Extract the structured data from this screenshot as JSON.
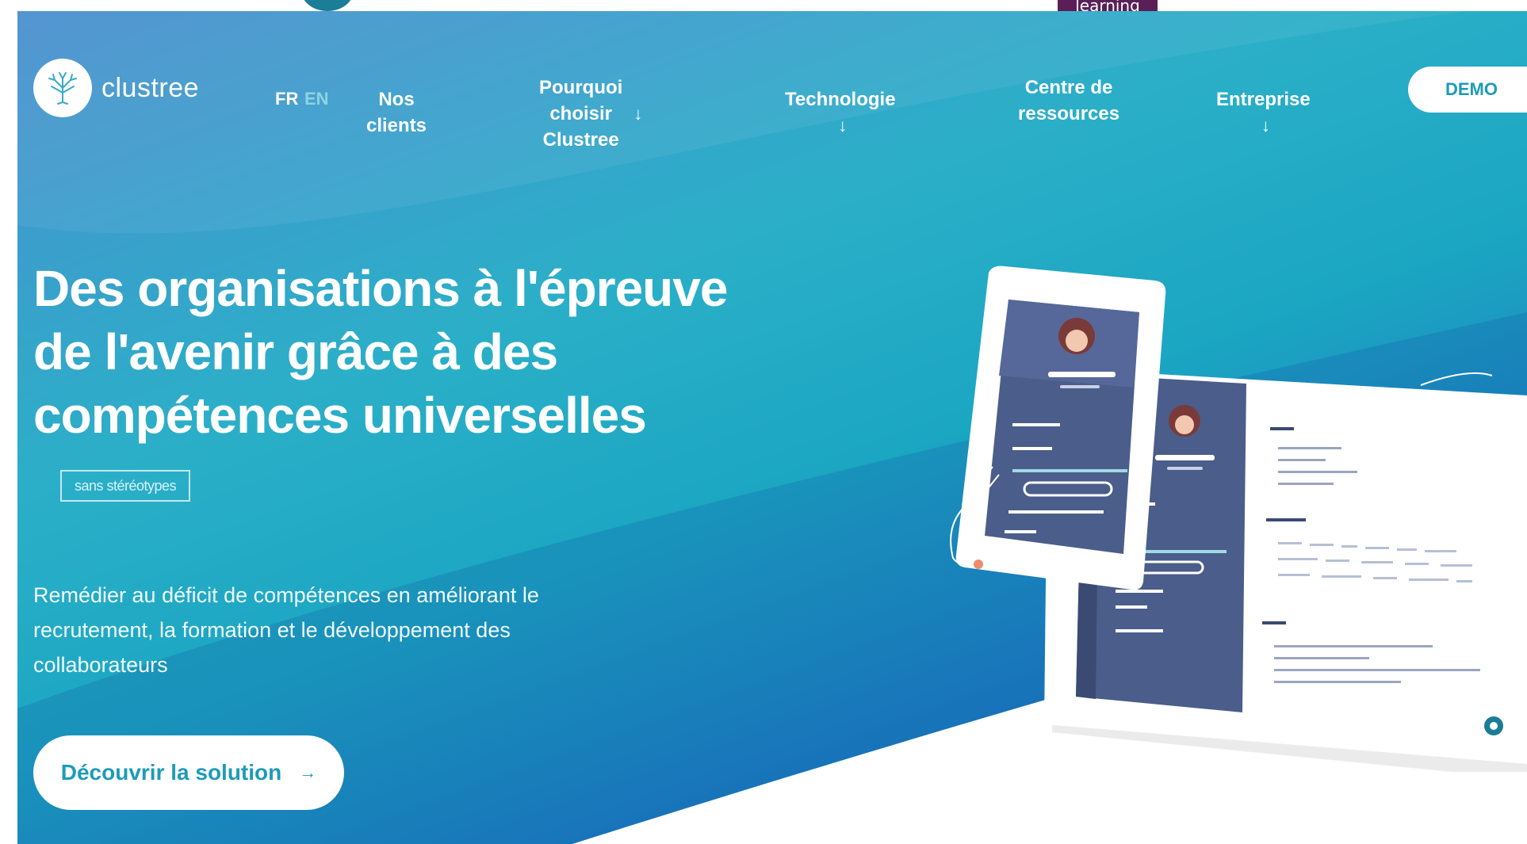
{
  "top_strip": {
    "badge_text": "learning"
  },
  "brand": {
    "name": "clustree",
    "logo_icon": "tree-icon"
  },
  "nav": {
    "lang_fr": "FR",
    "lang_en": "EN",
    "items": [
      {
        "label": "Nos clients"
      },
      {
        "label_line1": "Pourquoi choisir",
        "label_line2": "Clustree",
        "has_dropdown": true
      },
      {
        "label": "Technologie",
        "has_dropdown": true
      },
      {
        "label_line1": "Centre de",
        "label_line2": "ressources"
      },
      {
        "label": "Entreprise",
        "has_dropdown": true
      }
    ],
    "dropdown_icon": "arrow-down-icon",
    "demo_label": "DEMO"
  },
  "hero": {
    "headline_line1": "Des organisations à l'épreuve",
    "headline_line2": "de l'avenir grâce à des",
    "headline_line3": "compétences universelles",
    "tag": "sans stéréotypes",
    "subtext_line1": "Remédier au déficit de compétences en améliorant le",
    "subtext_line2": "recrutement, la formation et le développement des",
    "subtext_line3": "collaborateurs",
    "cta_label": "Découvrir la solution",
    "cta_icon": "arrow-right-icon"
  },
  "colors": {
    "accent": "#1e9bb7",
    "gradient_top": "#2bafc8",
    "gradient_bottom": "#1452a8",
    "app_sidebar": "#4b5d8a"
  }
}
